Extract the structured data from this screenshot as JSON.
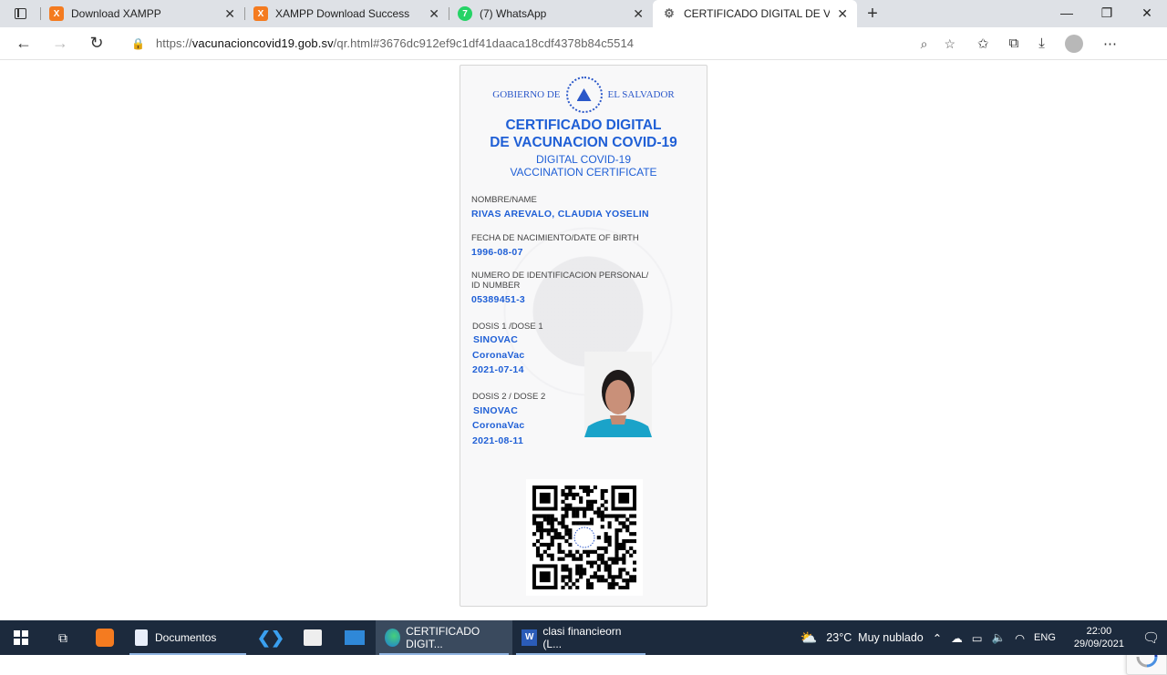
{
  "browser": {
    "tabs": [
      {
        "label": "Download XAMPP",
        "icon": "xampp-icon"
      },
      {
        "label": "XAMPP Download Success",
        "icon": "xampp-icon"
      },
      {
        "label": "(7) WhatsApp",
        "icon": "whatsapp-icon"
      },
      {
        "label": "CERTIFICADO DIGITAL DE VACUN",
        "icon": "gear-icon"
      }
    ],
    "url_prefix": "https://",
    "url_domain": "vacunacioncovid19.gob.sv",
    "url_path": "/qr.html#3676dc912ef9c1df41daaca18cdf4378b84c5514"
  },
  "certificate": {
    "gov_left": "GOBIERNO DE",
    "gov_right": "EL SALVADOR",
    "title_line1": "CERTIFICADO DIGITAL",
    "title_line2": "DE VACUNACION COVID-19",
    "subtitle_line1": "DIGITAL COVID-19",
    "subtitle_line2": "VACCINATION CERTIFICATE",
    "name_label": "NOMBRE/NAME",
    "name_value": "RIVAS AREVALO, CLAUDIA YOSELIN",
    "dob_label": "FECHA DE NACIMIENTO/DATE OF BIRTH",
    "dob_value": "1996-08-07",
    "id_label_line1": "NUMERO DE IDENTIFICACION PERSONAL/",
    "id_label_line2": "ID NUMBER",
    "id_value": "05389451-3",
    "dose1_label": "DOSIS 1 /DOSE 1",
    "dose1_vaccine": "SINOVAC",
    "dose1_product": "CoronaVac",
    "dose1_date": "2021-07-14",
    "dose2_label": "DOSIS 2 / DOSE 2",
    "dose2_vaccine": "SINOVAC",
    "dose2_product": "CoronaVac",
    "dose2_date": "2021-08-11"
  },
  "taskbar": {
    "apps": [
      {
        "label": "Documentos"
      },
      {
        "label": "CERTIFICADO DIGIT..."
      },
      {
        "label": "clasi financieorn (L..."
      }
    ],
    "weather": "23°C  Muy nublado",
    "lang": "ENG",
    "time": "22:00",
    "date": "29/09/2021"
  },
  "colors": {
    "accent": "#1f5fd6",
    "taskbar": "#1c2a3d"
  }
}
